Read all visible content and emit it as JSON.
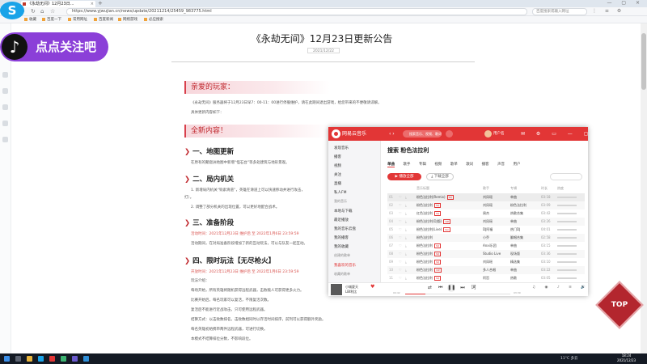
{
  "browser": {
    "tab_title": "《永劫无间》12月23日...",
    "url": "https://www.yjwujian.cn/news/update/20211214/25459_983775.html",
    "search_placeholder": "百度搜索或输入网址",
    "bookmarks": [
      "收藏",
      "百度一下",
      "常用网址",
      "百度新闻",
      "网络游戏",
      "必应搜索"
    ]
  },
  "follow_badge": {
    "text": "点点关注吧"
  },
  "article": {
    "title": "《永劫无间》12月23日更新公告",
    "date": "2021/12/22",
    "greeting": "亲爱的玩家：",
    "intro_lines": [
      "《永劫无间》服务器将于12月23日早7：00-11：00进行停服维护，请在此期间退出游戏，给您带来的不便敬请谅解。",
      "具体更新内容如下："
    ],
    "new_content_label": "全新内容！",
    "sections": [
      {
        "heading": "一、地图更新",
        "lines": [
          "在原有的聚窟洲地图中新增“怪石台”等多处建筑与地形景观。"
        ]
      },
      {
        "heading": "二、局内机关",
        "lines": [
          "1. 新增局内机关“钩索滑道”，英雄在滑道上可以快速移动并进行攻击，",
          "打）。",
          "2. 调整了部分机关的出现位置，可以更好地配合战术。"
        ]
      },
      {
        "heading": "三、准备阶段",
        "lines": [
          "活动时间：2021年12月23日 维护后 至 2022年1月6日 23:59:59",
          "活动期间，在对局准备阶段增加了新的互动玩法，可以与队友一起互动。"
        ]
      },
      {
        "heading": "四、限时玩法【无尽枪火】",
        "lines": [
          "开放时间：2021年12月23日 维护后 至 2022年1月6日 23:59:59",
          "玩法介绍：",
          "每场开始，所有英雄将随机获得远程武器，击败敌人可获得更多火力。",
          "比赛开始后，每名玩家可以复活，不限复活次数。",
          "复活后不能进行近战攻击，只可使用远程武器。",
          "结算方式：以击败数排名，击败数相同时以存活时间排序，前列可以获得额外奖励。",
          "每名英雄初始携带两件远程武器，可进行切换。",
          "本模式不结算排位分数，不影响段位。"
        ]
      }
    ]
  },
  "music": {
    "app_name": "网易云音乐",
    "search_placeholder": "搜索音乐、视频、歌词",
    "user_name": "用户名",
    "nav": [
      {
        "label": "发现音乐",
        "type": "item"
      },
      {
        "label": "播客",
        "type": "item"
      },
      {
        "label": "视频",
        "type": "item"
      },
      {
        "label": "关注",
        "type": "item"
      },
      {
        "label": "直播",
        "type": "item"
      },
      {
        "label": "私人FM",
        "type": "item"
      },
      {
        "label": "我的音乐",
        "type": "sub"
      },
      {
        "label": "本地与下载",
        "type": "item"
      },
      {
        "label": "最近播放",
        "type": "item"
      },
      {
        "label": "我的音乐云盘",
        "type": "item"
      },
      {
        "label": "我的播客",
        "type": "item"
      },
      {
        "label": "我的收藏",
        "type": "item"
      },
      {
        "label": "创建的歌单",
        "type": "sub"
      },
      {
        "label": "我喜欢的音乐",
        "type": "on"
      },
      {
        "label": "收藏的歌单",
        "type": "sub"
      }
    ],
    "playlist_title": "搜索 粉色法拉利",
    "tabs": [
      "单曲",
      "歌手",
      "专辑",
      "视频",
      "歌单",
      "歌词",
      "播客",
      "声音",
      "用户"
    ],
    "play_all": "播放全部",
    "download_all": "下载全部",
    "columns": [
      "音乐标题",
      "歌手",
      "专辑",
      "时长",
      "热度"
    ],
    "songs": [
      {
        "title": "粉色法拉利(Remix)",
        "tag": "SQ",
        "artist": "刘凤瑶",
        "album": "单曲",
        "time": "03:18"
      },
      {
        "title": "粉色法拉利",
        "tag": "SQ",
        "artist": "刘凤瑶",
        "album": "粉色法拉利",
        "time": "03:09"
      },
      {
        "title": "红色法拉利",
        "tag": "SQ",
        "artist": "周杰",
        "album": "热歌合集",
        "time": "03:42"
      },
      {
        "title": "粉色法拉利(DJ版)",
        "tag": "VIP",
        "artist": "刘凤瑶",
        "album": "单曲",
        "time": "03:26"
      },
      {
        "title": "粉色法拉利(Live)",
        "tag": "SQ",
        "artist": "DJ阿福",
        "album": "热门DJ",
        "time": "04:01"
      },
      {
        "title": "粉色法拉利",
        "tag": "",
        "artist": "小乔",
        "album": "翻唱合集",
        "time": "02:58"
      },
      {
        "title": "粉色法拉利",
        "tag": "SQ",
        "artist": "Anxi乐团",
        "album": "单曲",
        "time": "03:15"
      },
      {
        "title": "粉色法拉利",
        "tag": "SQ",
        "artist": "Studio Live",
        "album": "现场版",
        "time": "03:36"
      },
      {
        "title": "粉色法拉利",
        "tag": "SQ",
        "artist": "刘凤瑶",
        "album": "精选集",
        "time": "03:10"
      },
      {
        "title": "粉色法拉利",
        "tag": "VIP",
        "artist": "多人合唱",
        "album": "单曲",
        "time": "03:22"
      },
      {
        "title": "粉色法拉利",
        "tag": "SQ",
        "artist": "阿哲",
        "album": "热歌",
        "time": "03:05"
      },
      {
        "title": "粉色法拉利",
        "tag": "",
        "artist": "Lil Jerry",
        "album": "单曲",
        "time": "03:40"
      },
      {
        "title": "粉色法拉利",
        "tag": "",
        "artist": "刘凤瑶",
        "album": "单曲",
        "time": "03:18"
      }
    ],
    "now_playing_title": "小城夏天",
    "now_playing_artist": "LBI利比",
    "current_time": "00:42",
    "total_time": "03:39",
    "progress": 0.19
  },
  "top_button": "TOP",
  "taskbar": {
    "tray_text": "11°C 多云",
    "time": "18:24",
    "date": "2021/12/23"
  },
  "colors": {
    "accent_red": "#e23636",
    "section_red": "#c0272d",
    "badge_purple": "#8b3fd8",
    "top_button": "#b3262e"
  }
}
